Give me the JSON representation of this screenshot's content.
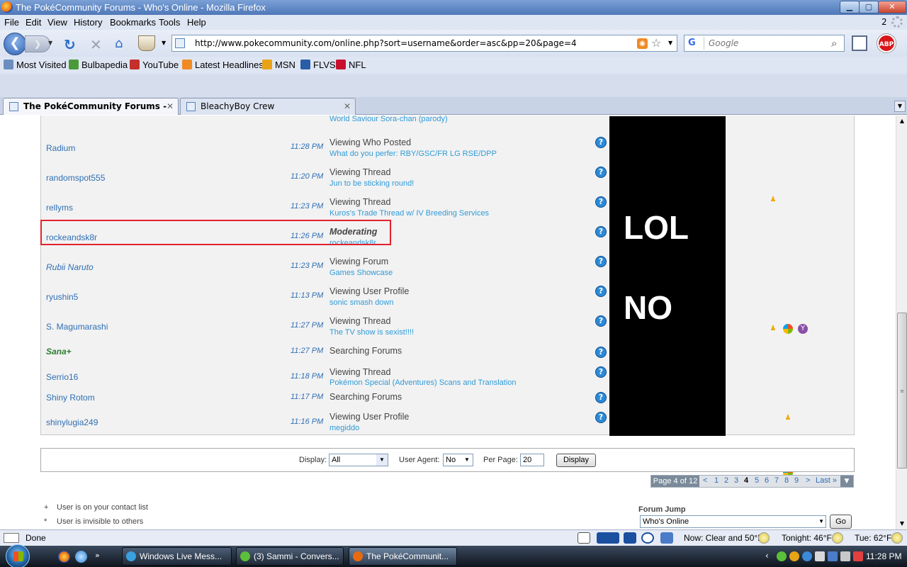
{
  "window": {
    "title": "The PokéCommunity Forums - Who's Online - Mozilla Firefox",
    "min": "▁",
    "max": "▢",
    "close": "✕"
  },
  "menu": {
    "items": [
      "File",
      "Edit",
      "View",
      "History",
      "Bookmarks",
      "Tools",
      "Help"
    ],
    "count": "2"
  },
  "nav": {
    "url": "http://www.pokecommunity.com/online.php?sort=username&order=asc&pp=20&page=4",
    "search_engine": "G",
    "search_placeholder": "Google",
    "abp": "ABP"
  },
  "bookmarks": [
    {
      "label": "Most Visited",
      "color": "#6c8ebf"
    },
    {
      "label": "Bulbapedia",
      "color": "#4a9a3a"
    },
    {
      "label": "YouTube",
      "color": "#c4302b"
    },
    {
      "label": "Latest Headlines",
      "color": "#f08a24"
    },
    {
      "label": "MSN",
      "color": "#e8a317"
    },
    {
      "label": "FLVS",
      "color": "#2a5da8"
    },
    {
      "label": "NFL",
      "color": "#c8102e"
    }
  ],
  "tabs": [
    {
      "label": "The PokéCommunity Forums - W...",
      "close": "✕"
    },
    {
      "label": "BleachyBoy Crew",
      "close": "✕"
    }
  ],
  "partial_row": {
    "detail": "World Saviour Sora-chan (parody)"
  },
  "rows": [
    {
      "name": "Radium",
      "time": "11:28 PM",
      "action": "Viewing Who Posted",
      "detail": "What do you perfer: RBY/GSC/FR LG RSE/DPP"
    },
    {
      "name": "randomspot555",
      "time": "11:20 PM",
      "action": "Viewing Thread",
      "detail": "Jun to be sticking round!"
    },
    {
      "name": "rellyms",
      "time": "11:23 PM",
      "action": "Viewing Thread",
      "detail": "Kuros's Trade Thread w/ IV Breeding Services"
    },
    {
      "name": "rockeandsk8r",
      "time": "11:26 PM",
      "action": "Moderating",
      "detail": "rockeandsk8r"
    },
    {
      "name": "Rubii Naruto",
      "time": "11:23 PM",
      "action": "Viewing Forum",
      "detail": "Games Showcase"
    },
    {
      "name": "ryushin5",
      "time": "11:13 PM",
      "action": "Viewing User Profile",
      "detail": "sonic smash down"
    },
    {
      "name": "S. Magumarashi",
      "time": "11:27 PM",
      "action": "Viewing Thread",
      "detail": "The TV show is sexist!!!!"
    },
    {
      "name": "Sana+",
      "time": "11:27 PM",
      "action": "Searching Forums",
      "detail": ""
    },
    {
      "name": "Serrio16",
      "time": "11:18 PM",
      "action": "Viewing Thread",
      "detail": "Pokémon Special (Adventures) Scans and Translation"
    },
    {
      "name": "Shiny Rotom",
      "time": "11:17 PM",
      "action": "Searching Forums",
      "detail": ""
    },
    {
      "name": "shinylugia249",
      "time": "11:16 PM",
      "action": "Viewing User Profile",
      "detail": "megiddo"
    }
  ],
  "qmark": "?",
  "overlay": {
    "lol": "LOL",
    "no": "NO"
  },
  "ua_icons": [
    "aim-icon",
    "windows-icon",
    "yahoo-icon"
  ],
  "display": {
    "display_label": "Display:",
    "display_value": "All",
    "agent_label": "User Agent:",
    "agent_value": "No",
    "perpage_label": "Per Page:",
    "perpage_value": "20",
    "button": "Display"
  },
  "pagenav": {
    "info": "Page 4 of 12",
    "links": [
      "<",
      "1",
      "2",
      "3",
      "4",
      "5",
      "6",
      "7",
      "8",
      "9",
      ">",
      "Last »"
    ],
    "current": "4"
  },
  "legend": [
    {
      "sym": "+",
      "text": "User is on your contact list"
    },
    {
      "sym": "*",
      "text": "User is invisible to others"
    }
  ],
  "forum_jump": {
    "label": "Forum Jump",
    "value": "Who's Online",
    "go": "Go"
  },
  "status": {
    "text": "Done",
    "weather_now": "Now: Clear and 50°F",
    "weather_tonight": "Tonight: 46°F",
    "weather_tue": "Tue: 62°F"
  },
  "taskbar": {
    "tasks": [
      {
        "label": "Windows Live Mess...",
        "color": "#3aa0e0"
      },
      {
        "label": "(3) Sammi - Convers...",
        "color": "#5cbf3a"
      },
      {
        "label": "The PokéCommunit...",
        "color": "#e86a10"
      }
    ],
    "clock": "11:28 PM"
  }
}
